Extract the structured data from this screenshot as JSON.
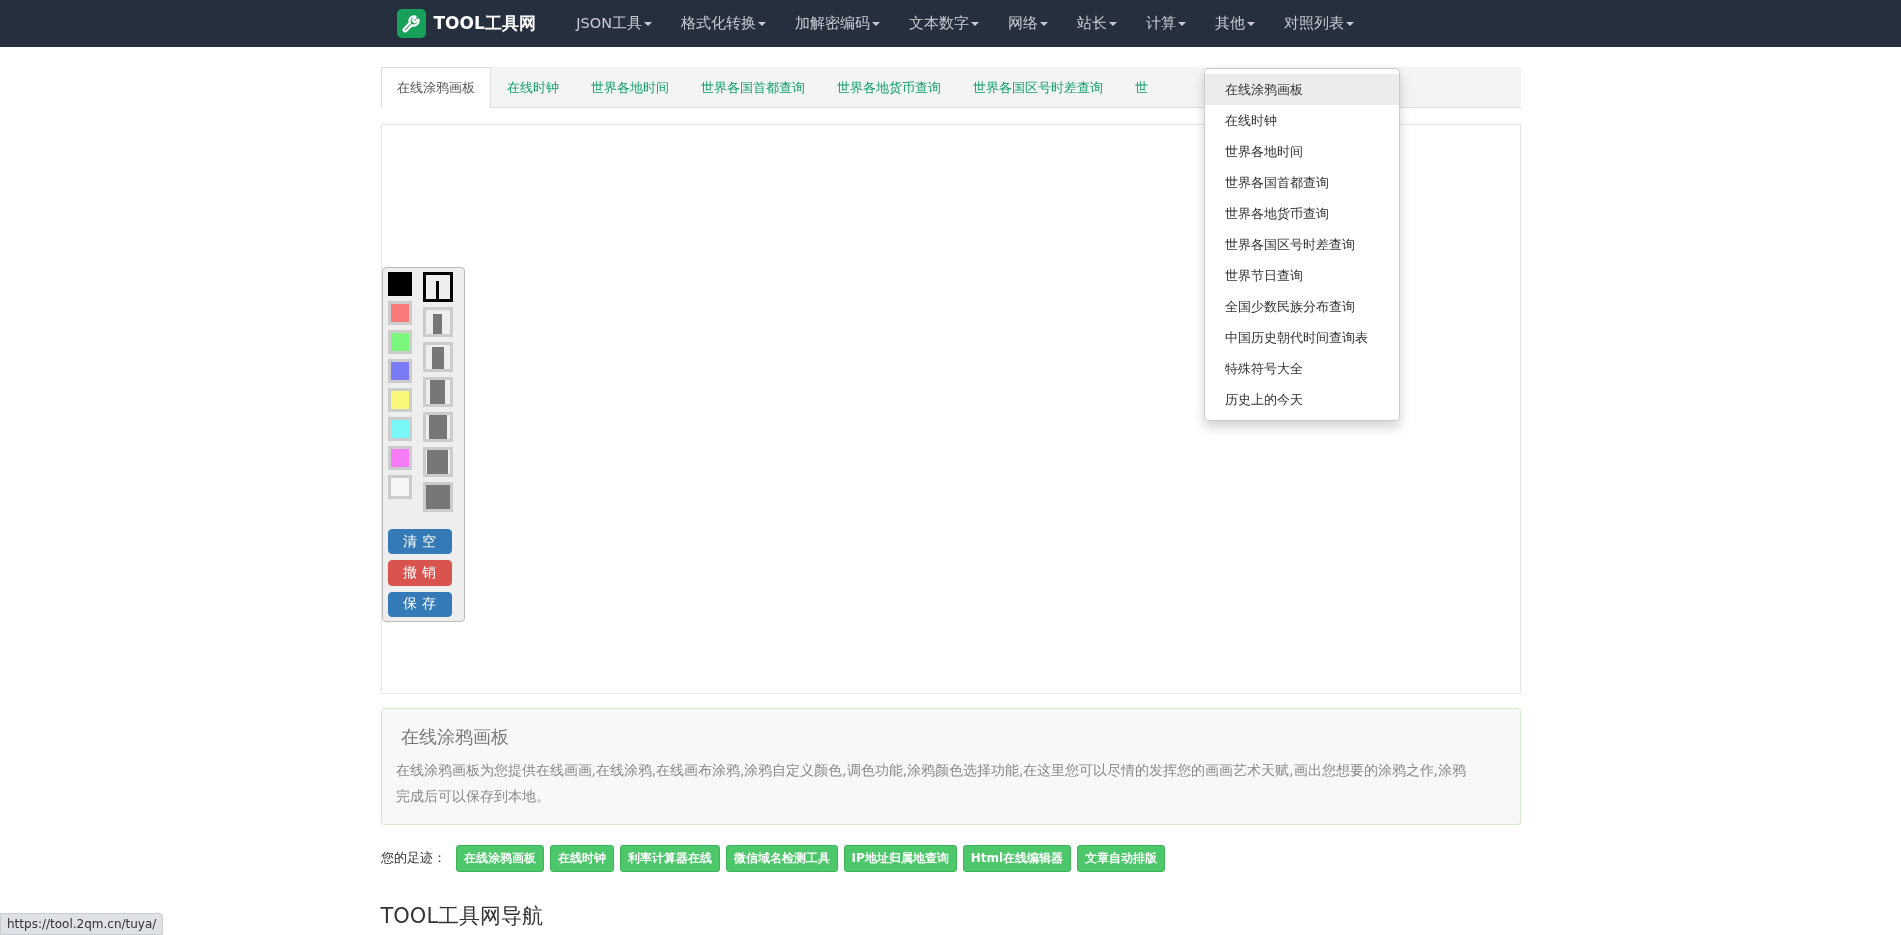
{
  "nav": {
    "brand": "TOOL工具网",
    "items": [
      "JSON工具",
      "格式化转换",
      "加解密编码",
      "文本数字",
      "网络",
      "站长",
      "计算",
      "其他",
      "对照列表"
    ]
  },
  "tabs": [
    {
      "label": "在线涂鸦画板",
      "selected": true
    },
    {
      "label": "在线时钟",
      "selected": false
    },
    {
      "label": "世界各地时间",
      "selected": false
    },
    {
      "label": "世界各国首都查询",
      "selected": false
    },
    {
      "label": "世界各地货币查询",
      "selected": false
    },
    {
      "label": "世界各国区号时差查询",
      "selected": false
    },
    {
      "label": "世",
      "selected": false
    }
  ],
  "dropdown": [
    {
      "label": "在线涂鸦画板",
      "highlighted": true
    },
    {
      "label": "在线时钟",
      "highlighted": false
    },
    {
      "label": "世界各地时间",
      "highlighted": false
    },
    {
      "label": "世界各国首都查询",
      "highlighted": false
    },
    {
      "label": "世界各地货币查询",
      "highlighted": false
    },
    {
      "label": "世界各国区号时差查询",
      "highlighted": false
    },
    {
      "label": "世界节日查询",
      "highlighted": false
    },
    {
      "label": "全国少数民族分布查询",
      "highlighted": false
    },
    {
      "label": "中国历史朝代时间查询表",
      "highlighted": false
    },
    {
      "label": "特殊符号大全",
      "highlighted": false
    },
    {
      "label": "历史上的今天",
      "highlighted": false
    }
  ],
  "palette": {
    "colors": [
      {
        "color": "#000000",
        "selected": true
      },
      {
        "color": "#f77a78",
        "selected": false
      },
      {
        "color": "#7af77a",
        "selected": false
      },
      {
        "color": "#7a7af7",
        "selected": false
      },
      {
        "color": "#f7f77a",
        "selected": false
      },
      {
        "color": "#7af7f7",
        "selected": false
      },
      {
        "color": "#f77af7",
        "selected": false
      },
      {
        "color": "#f5f5f5",
        "selected": false
      }
    ],
    "sizes": [
      {
        "selected": true
      },
      {
        "selected": false
      },
      {
        "selected": false
      },
      {
        "selected": false
      },
      {
        "selected": false
      },
      {
        "selected": false
      },
      {
        "selected": false
      }
    ],
    "buttons": [
      {
        "label": "清 空",
        "kind": "primary"
      },
      {
        "label": "撤 销",
        "kind": "danger"
      },
      {
        "label": "保 存",
        "kind": "primary"
      }
    ]
  },
  "info": {
    "title": "在线涂鸦画板",
    "text": "在线涂鸦画板为您提供在线画画,在线涂鸦,在线画布涂鸦,涂鸦自定义颜色,调色功能,涂鸦颜色选择功能,在这里您可以尽情的发挥您的画画艺术天赋,画出您想要的涂鸦之作,涂鸦完成后可以保存到本地。"
  },
  "footprints": {
    "label": "您的足迹：",
    "items": [
      "在线涂鸦画板",
      "在线时钟",
      "利率计算器在线",
      "微信域名检测工具",
      "IP地址归属地查询",
      "Html在线编辑器",
      "文章自动排版"
    ]
  },
  "section_heading": "TOOL工具网导航",
  "status_url": "https://tool.2qm.cn/tuya/"
}
